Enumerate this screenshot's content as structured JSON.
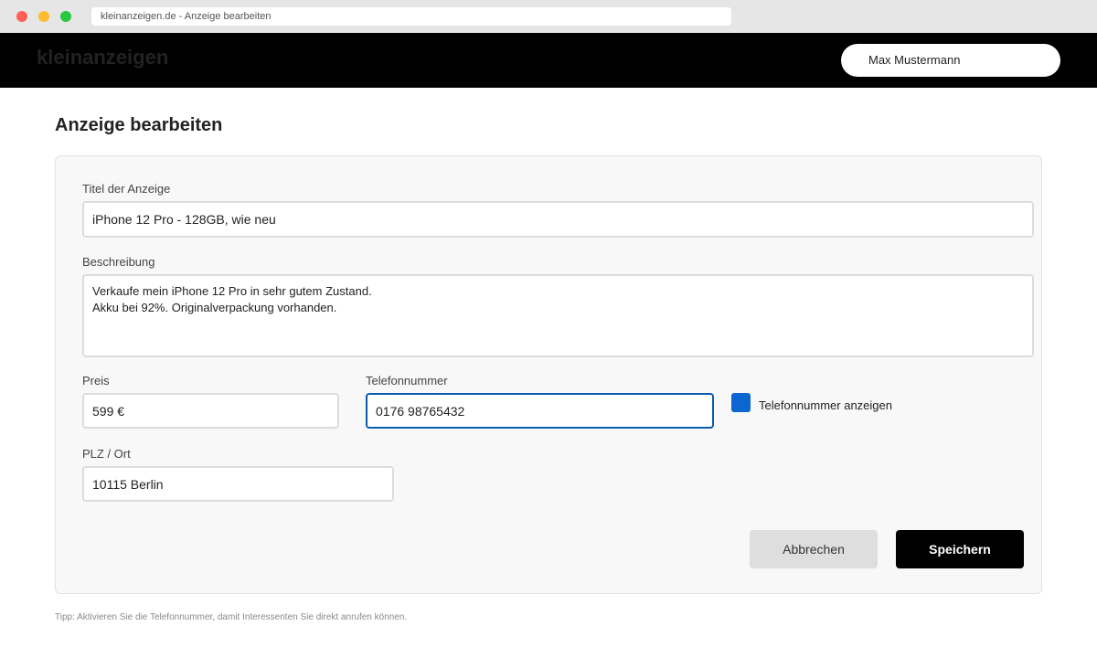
{
  "browser": {
    "url_title": "kleinanzeigen.de - Anzeige bearbeiten"
  },
  "header": {
    "logo": "kleinanzeigen",
    "user_name": "Max Mustermann"
  },
  "page": {
    "title": "Anzeige bearbeiten"
  },
  "form": {
    "title_label": "Titel der Anzeige",
    "title_value": "iPhone 12 Pro - 128GB, wie neu",
    "description_label": "Beschreibung",
    "description_value": "Verkaufe mein iPhone 12 Pro in sehr gutem Zustand.\nAkku bei 92%. Originalverpackung vorhanden.",
    "price_label": "Preis",
    "price_value": "599 €",
    "phone_label": "Telefonnummer",
    "phone_value": "0176 98765432",
    "show_phone_label": "Telefonnummer anzeigen",
    "location_label": "PLZ / Ort",
    "location_value": "10115 Berlin"
  },
  "actions": {
    "cancel_label": "Abbrechen",
    "save_label": "Speichern"
  },
  "footer": {
    "tip": "Tipp: Aktivieren Sie die Telefonnummer, damit Interessenten Sie direkt anrufen können."
  },
  "colors": {
    "accent": "#0b66d1",
    "focus_border": "#0b5cad",
    "header_bg": "#000000"
  }
}
